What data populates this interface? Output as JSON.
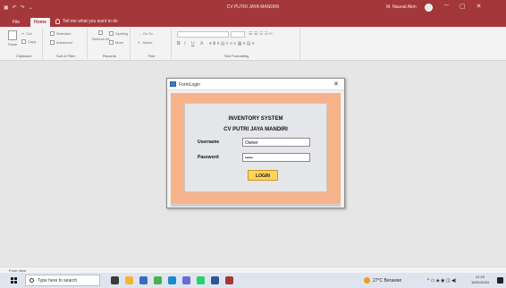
{
  "app": {
    "doc_title": "CV PUTRI JAYA MANDIRI",
    "user_name": "M. Nauval Akm",
    "qat_icons": [
      "save-icon",
      "undo-icon",
      "redo-icon",
      "customize-qat-icon"
    ]
  },
  "window_buttons": {
    "minimize": "─",
    "restore": "▢",
    "close": "✕"
  },
  "tabs": [
    {
      "label": "File",
      "active": false
    },
    {
      "label": "Home",
      "active": true
    }
  ],
  "tell_me": "Tell me what you want to do",
  "ribbon": {
    "clipboard": {
      "label": "Clipboard",
      "paste": "Paste",
      "cut": "Cut",
      "copy": "Copy"
    },
    "sort_filter": {
      "label": "Sort & Filter",
      "selection": "Selection",
      "advanced": "Advanced"
    },
    "records": {
      "label": "Records",
      "refresh": "Refresh All",
      "spelling": "Spelling",
      "more": "More"
    },
    "find": {
      "label": "Find",
      "goto": "Go To",
      "select": "Select"
    },
    "text_formatting": {
      "label": "Text Formatting",
      "bold": "B",
      "italic": "I",
      "underline": "U",
      "font_color": "A"
    }
  },
  "dialog": {
    "title": "FormLogin",
    "heading1": "INVENTORY SYSTEM",
    "heading2": "CV PUTRI JAYA MANDIRI",
    "username_label": "Username",
    "username_value": "Owner",
    "password_label": "Password",
    "password_value": "•••••",
    "login_button": "LOGIN",
    "close": "✕"
  },
  "status_bar": {
    "text": "Form View"
  },
  "taskbar": {
    "search_placeholder": "Type here to search",
    "weather": "27°C  Berawan",
    "tray": "^  ▭  ◈  ◉  ◫  ◀)",
    "time": "21:23",
    "date": "10/01/2024",
    "app_icons": [
      {
        "name": "task-view-icon",
        "color": "#3b3b3b"
      },
      {
        "name": "file-explorer-icon",
        "color": "#f2b635"
      },
      {
        "name": "store-icon",
        "color": "#3b6cbf"
      },
      {
        "name": "chrome-icon",
        "color": "#4caf50"
      },
      {
        "name": "edge-icon",
        "color": "#1e88d2"
      },
      {
        "name": "app-icon",
        "color": "#6b6bd6"
      },
      {
        "name": "whatsapp-icon",
        "color": "#25d366"
      },
      {
        "name": "word-icon",
        "color": "#2b579a"
      },
      {
        "name": "access-icon",
        "color": "#a4373a"
      }
    ]
  },
  "colors": {
    "access_accent": "#a4373a",
    "form_background": "#f6b389",
    "login_button": "#ffd45f"
  }
}
